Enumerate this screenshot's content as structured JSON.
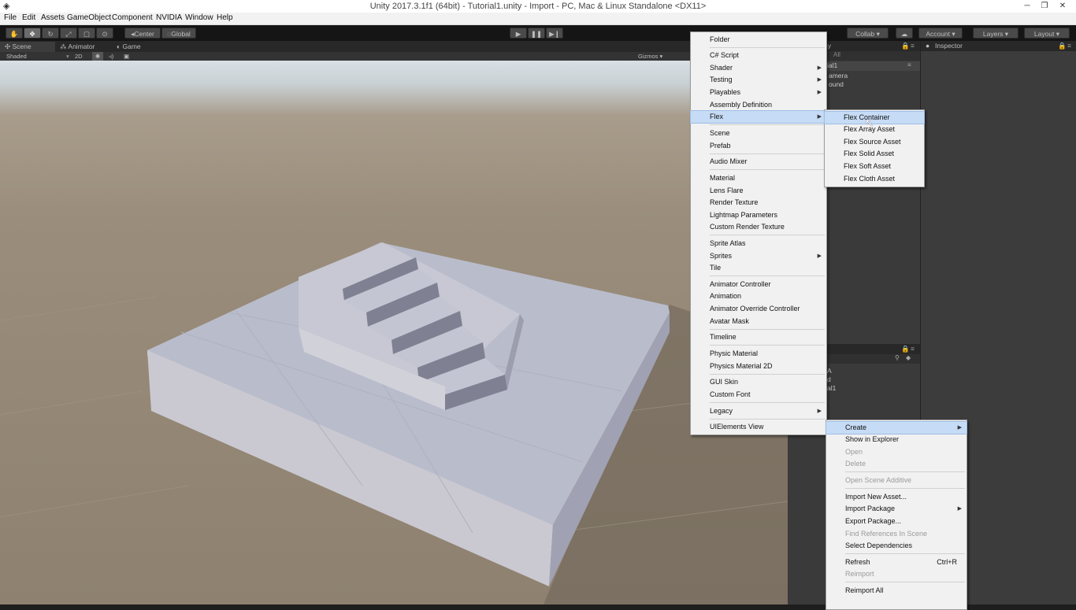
{
  "window": {
    "title": "Unity 2017.3.1f1 (64bit) - Tutorial1.unity - Import - PC, Mac & Linux Standalone <DX11>",
    "controls": [
      "─",
      "❐",
      "✕"
    ]
  },
  "menubar": [
    "File",
    "Edit",
    "Assets",
    "GameObject",
    "Component",
    "NVIDIA",
    "Window",
    "Help"
  ],
  "toolbar": {
    "tools": [
      "hand-tool",
      "move-tool",
      "rotate-tool",
      "scale-tool",
      "rect-tool",
      "transform-tool"
    ],
    "pivot": "Center",
    "space": "Global",
    "collab": "Collab ▾",
    "account": "Account",
    "layers": "Layers",
    "layout": "Layout"
  },
  "tabs": {
    "scene": "Scene",
    "animator": "Animator",
    "game": "Game",
    "inspector": "Inspector"
  },
  "scenebar": {
    "shading": "Shaded",
    "mode2d": "2D",
    "gizmos": "Gizmos ▾",
    "search": "All"
  },
  "hierarchy": {
    "lines": [
      "ial1",
      "amera",
      "ound"
    ]
  },
  "project": {
    "lines": [
      "A",
      "d",
      "al1"
    ]
  },
  "create_menu": {
    "items": [
      {
        "label": "Folder"
      },
      {
        "label": "C# Script"
      },
      {
        "label": "Shader",
        "sub": true
      },
      {
        "label": "Testing",
        "sub": true
      },
      {
        "label": "Playables",
        "sub": true
      },
      {
        "label": "Assembly Definition"
      },
      {
        "label": "Flex",
        "sub": true,
        "highlighted": true
      },
      {
        "label": "Scene"
      },
      {
        "label": "Prefab"
      },
      {
        "label": "Audio Mixer"
      },
      {
        "label": "Material"
      },
      {
        "label": "Lens Flare"
      },
      {
        "label": "Render Texture"
      },
      {
        "label": "Lightmap Parameters"
      },
      {
        "label": "Custom Render Texture"
      },
      {
        "label": "Sprite Atlas"
      },
      {
        "label": "Sprites",
        "sub": true
      },
      {
        "label": "Tile"
      },
      {
        "label": "Animator Controller"
      },
      {
        "label": "Animation"
      },
      {
        "label": "Animator Override Controller"
      },
      {
        "label": "Avatar Mask"
      },
      {
        "label": "Timeline"
      },
      {
        "label": "Physic Material"
      },
      {
        "label": "Physics Material 2D"
      },
      {
        "label": "GUI Skin"
      },
      {
        "label": "Custom Font"
      },
      {
        "label": "Legacy",
        "sub": true
      },
      {
        "label": "UIElements View"
      }
    ]
  },
  "flex_menu": {
    "items": [
      {
        "label": "Flex Container",
        "highlighted": true
      },
      {
        "label": "Flex Array Asset"
      },
      {
        "label": "Flex Source Asset"
      },
      {
        "label": "Flex Solid Asset"
      },
      {
        "label": "Flex Soft Asset"
      },
      {
        "label": "Flex Cloth Asset"
      }
    ]
  },
  "context_menu": {
    "items": [
      {
        "label": "Create",
        "sub": true,
        "highlighted": true
      },
      {
        "label": "Show in Explorer"
      },
      {
        "label": "Open",
        "disabled": true
      },
      {
        "label": "Delete",
        "disabled": true
      },
      {
        "label": "Open Scene Additive",
        "disabled": true
      },
      {
        "label": "Import New Asset..."
      },
      {
        "label": "Import Package",
        "sub": true
      },
      {
        "label": "Export Package..."
      },
      {
        "label": "Find References In Scene",
        "disabled": true
      },
      {
        "label": "Select Dependencies"
      },
      {
        "label": "Refresh",
        "shortcut": "Ctrl+R"
      },
      {
        "label": "Reimport",
        "disabled": true
      },
      {
        "label": "Reimport All"
      }
    ]
  },
  "colors": {
    "menu_bg": "#f1f1f1",
    "highlight": "#c6dbf5",
    "editor_dark": "#1e1e1e"
  }
}
